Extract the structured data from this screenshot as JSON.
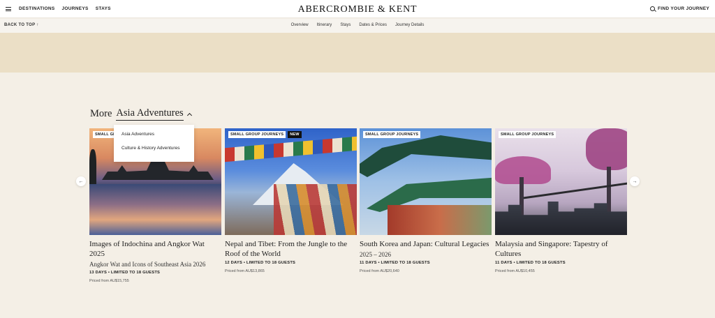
{
  "header": {
    "nav": [
      "DESTINATIONS",
      "JOURNEYS",
      "STAYS"
    ],
    "logo": "ABERCROMBIE & KENT",
    "find": "FIND YOUR JOURNEY"
  },
  "subnav": {
    "back_to_top": "BACK TO TOP ↑",
    "links": [
      "Overview",
      "Itinerary",
      "Stays",
      "Dates & Prices",
      "Journey Details"
    ]
  },
  "section": {
    "title_prefix": "More",
    "title_link": "Asia Adventures"
  },
  "dropdown": {
    "options": [
      "Asia Adventures",
      "Culture & History Adventures"
    ]
  },
  "arrows": {
    "prev": "←",
    "next": "→"
  },
  "cards": [
    {
      "badges": [
        "SMALL GR"
      ],
      "title": "Images of Indochina and Angkor Wat 2025",
      "subtitle": "Angkor Wat and Icons of Southeast Asia 2026",
      "meta": "13 DAYS • LIMITED TO 18 GUESTS",
      "price": "Priced from AU$15,755"
    },
    {
      "badges": [
        "SMALL GROUP JOURNEYS",
        "NEW"
      ],
      "title": "Nepal and Tibet: From the Jungle to the Roof of the World",
      "subtitle": "",
      "meta": "12 DAYS • LIMITED TO 18 GUESTS",
      "price": "Priced from AU$13,865"
    },
    {
      "badges": [
        "SMALL GROUP JOURNEYS"
      ],
      "title": "South Korea and Japan: Cultural Legacies",
      "subtitle": "2025 – 2026",
      "meta": "11 DAYS • LIMITED TO 18 GUESTS",
      "price": "Priced from AU$20,640"
    },
    {
      "badges": [
        "SMALL GROUP JOURNEYS"
      ],
      "title": "Malaysia and Singapore: Tapestry of Cultures",
      "subtitle": "",
      "meta": "11 DAYS • LIMITED TO 18 GUESTS",
      "price": "Priced from AU$10,455"
    }
  ]
}
